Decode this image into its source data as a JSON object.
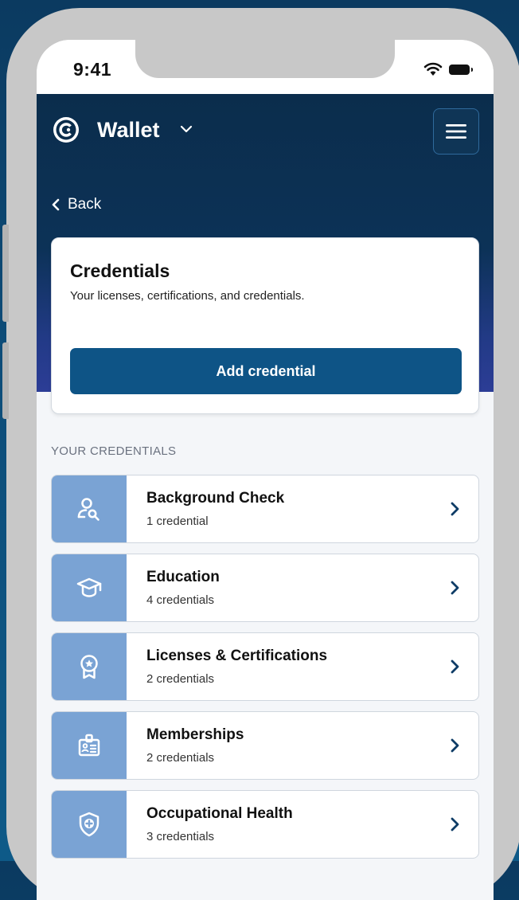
{
  "status_bar": {
    "time": "9:41"
  },
  "header": {
    "title": "Wallet"
  },
  "nav": {
    "back_label": "Back"
  },
  "credentials_card": {
    "title": "Credentials",
    "subtitle": "Your licenses, certifications, and credentials.",
    "add_button_label": "Add credential"
  },
  "list": {
    "section_label": "YOUR CREDENTIALS",
    "items": [
      {
        "name": "Background Check",
        "count": "1 credential",
        "icon": "person-search-icon"
      },
      {
        "name": "Education",
        "count": "4 credentials",
        "icon": "graduation-cap-icon"
      },
      {
        "name": "Licenses & Certifications",
        "count": "2 credentials",
        "icon": "award-ribbon-icon"
      },
      {
        "name": "Memberships",
        "count": "2 credentials",
        "icon": "id-badge-icon"
      },
      {
        "name": "Occupational Health",
        "count": "3 credentials",
        "icon": "shield-plus-icon"
      }
    ]
  },
  "colors": {
    "header_dark": "#0b2d4c",
    "header_gradient_end": "#2c3d96",
    "primary_button": "#0e5486",
    "icon_tile": "#7aa3d4",
    "chevron": "#0e3c66",
    "page_background": "#f4f6f9"
  }
}
